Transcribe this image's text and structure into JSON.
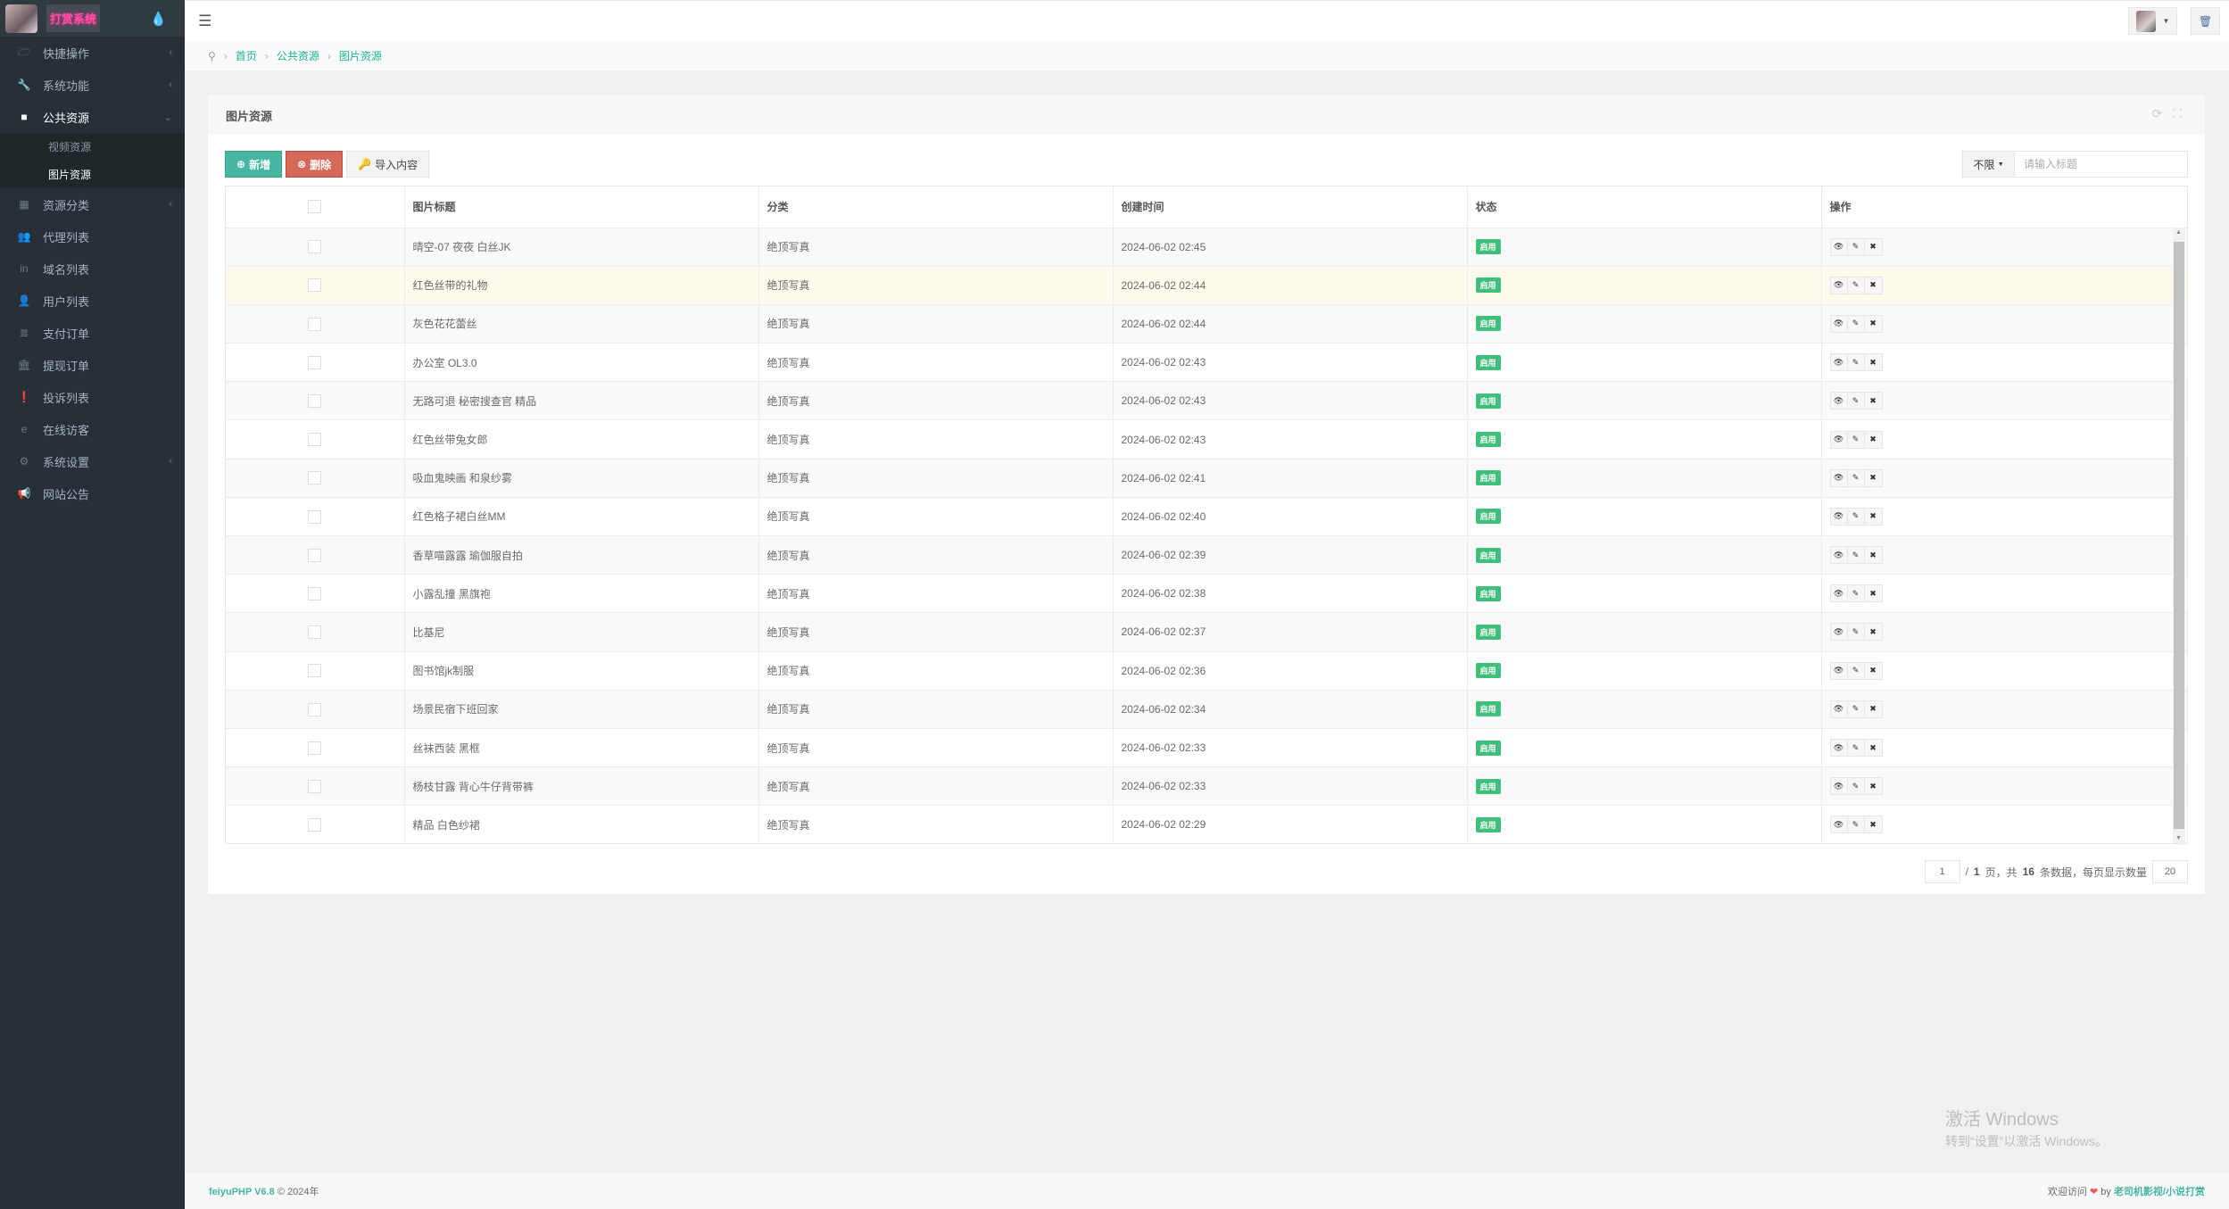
{
  "app": {
    "brand": "打赏系统"
  },
  "colors": {
    "accent": "#1ab394",
    "add_button": "#46b6a2",
    "delete_button": "#d4695a",
    "status_badge": "#3fc07a",
    "sidebar_bg": "#263036",
    "hover_row": "#fffbec"
  },
  "sidebar": {
    "items": [
      {
        "label": "快捷操作",
        "icon": "folder-open-icon",
        "has_submenu": true
      },
      {
        "label": "系统功能",
        "icon": "wrench-icon",
        "has_submenu": true
      },
      {
        "label": "公共资源",
        "icon": "video-camera-icon",
        "has_submenu": true,
        "expanded": true,
        "children": [
          {
            "label": "视频资源"
          },
          {
            "label": "图片资源",
            "active": true
          }
        ]
      },
      {
        "label": "资源分类",
        "icon": "grid-icon",
        "has_submenu": true
      },
      {
        "label": "代理列表",
        "icon": "users-icon"
      },
      {
        "label": "域名列表",
        "icon": "linkedin-icon"
      },
      {
        "label": "用户列表",
        "icon": "user-icon"
      },
      {
        "label": "支付订单",
        "icon": "database-icon"
      },
      {
        "label": "提现订单",
        "icon": "bank-icon"
      },
      {
        "label": "投诉列表",
        "icon": "exclamation-circle-icon"
      },
      {
        "label": "在线访客",
        "icon": "ie-icon"
      },
      {
        "label": "系统设置",
        "icon": "gear-icon",
        "has_submenu": true
      },
      {
        "label": "网站公告",
        "icon": "bullhorn-icon"
      }
    ]
  },
  "breadcrumb": [
    "首页",
    "公共资源",
    "图片资源"
  ],
  "panel": {
    "title": "图片资源",
    "toolbar": {
      "add_label": "新增",
      "delete_label": "删除",
      "import_label": "导入内容"
    },
    "filter": {
      "selected": "不限",
      "placeholder": "请输入标题"
    },
    "columns": [
      "图片标题",
      "分类",
      "创建时间",
      "状态",
      "操作"
    ],
    "rows": [
      {
        "title": "晴空-07 夜夜 白丝JK",
        "category": "绝顶写真",
        "created": "2024-06-02 02:45",
        "status": "启用"
      },
      {
        "title": "红色丝带的礼物",
        "category": "绝顶写真",
        "created": "2024-06-02 02:44",
        "status": "启用"
      },
      {
        "title": "灰色花花蕾丝",
        "category": "绝顶写真",
        "created": "2024-06-02 02:44",
        "status": "启用"
      },
      {
        "title": "办公室 OL3.0",
        "category": "绝顶写真",
        "created": "2024-06-02 02:43",
        "status": "启用"
      },
      {
        "title": "无路可退 秘密搜查官 精品",
        "category": "绝顶写真",
        "created": "2024-06-02 02:43",
        "status": "启用"
      },
      {
        "title": "红色丝带兔女郎",
        "category": "绝顶写真",
        "created": "2024-06-02 02:43",
        "status": "启用"
      },
      {
        "title": "吸血鬼映画 和泉纱雾",
        "category": "绝顶写真",
        "created": "2024-06-02 02:41",
        "status": "启用"
      },
      {
        "title": "红色格子裙白丝MM",
        "category": "绝顶写真",
        "created": "2024-06-02 02:40",
        "status": "启用"
      },
      {
        "title": "香草喵露露 瑜伽服自拍",
        "category": "绝顶写真",
        "created": "2024-06-02 02:39",
        "status": "启用"
      },
      {
        "title": "小露乱撞 黑旗袍",
        "category": "绝顶写真",
        "created": "2024-06-02 02:38",
        "status": "启用"
      },
      {
        "title": "比基尼",
        "category": "绝顶写真",
        "created": "2024-06-02 02:37",
        "status": "启用"
      },
      {
        "title": "图书馆jk制服",
        "category": "绝顶写真",
        "created": "2024-06-02 02:36",
        "status": "启用"
      },
      {
        "title": "场景民宿下班回家",
        "category": "绝顶写真",
        "created": "2024-06-02 02:34",
        "status": "启用"
      },
      {
        "title": "丝袜西装 黑框",
        "category": "绝顶写真",
        "created": "2024-06-02 02:33",
        "status": "启用"
      },
      {
        "title": "杨枝甘露 背心牛仔背带裤",
        "category": "绝顶写真",
        "created": "2024-06-02 02:33",
        "status": "启用"
      },
      {
        "title": "精品 白色纱裙",
        "category": "绝顶写真",
        "created": "2024-06-02 02:29",
        "status": "启用"
      }
    ],
    "pagination": {
      "current_page": "1",
      "prefix": "/",
      "total_pages": "1",
      "pages_label": "页，共",
      "total_count": "16",
      "count_label": "条数据，每页显示数量",
      "page_size": "20"
    }
  },
  "watermark": {
    "line1": "激活 Windows",
    "line2": "转到“设置”以激活 Windows。"
  },
  "footer": {
    "brand": "feiyuPHP V6.8",
    "copyright": "© 2024年",
    "welcome": "欢迎访问",
    "by": "by",
    "link": "老司机影视/小说打赏"
  }
}
